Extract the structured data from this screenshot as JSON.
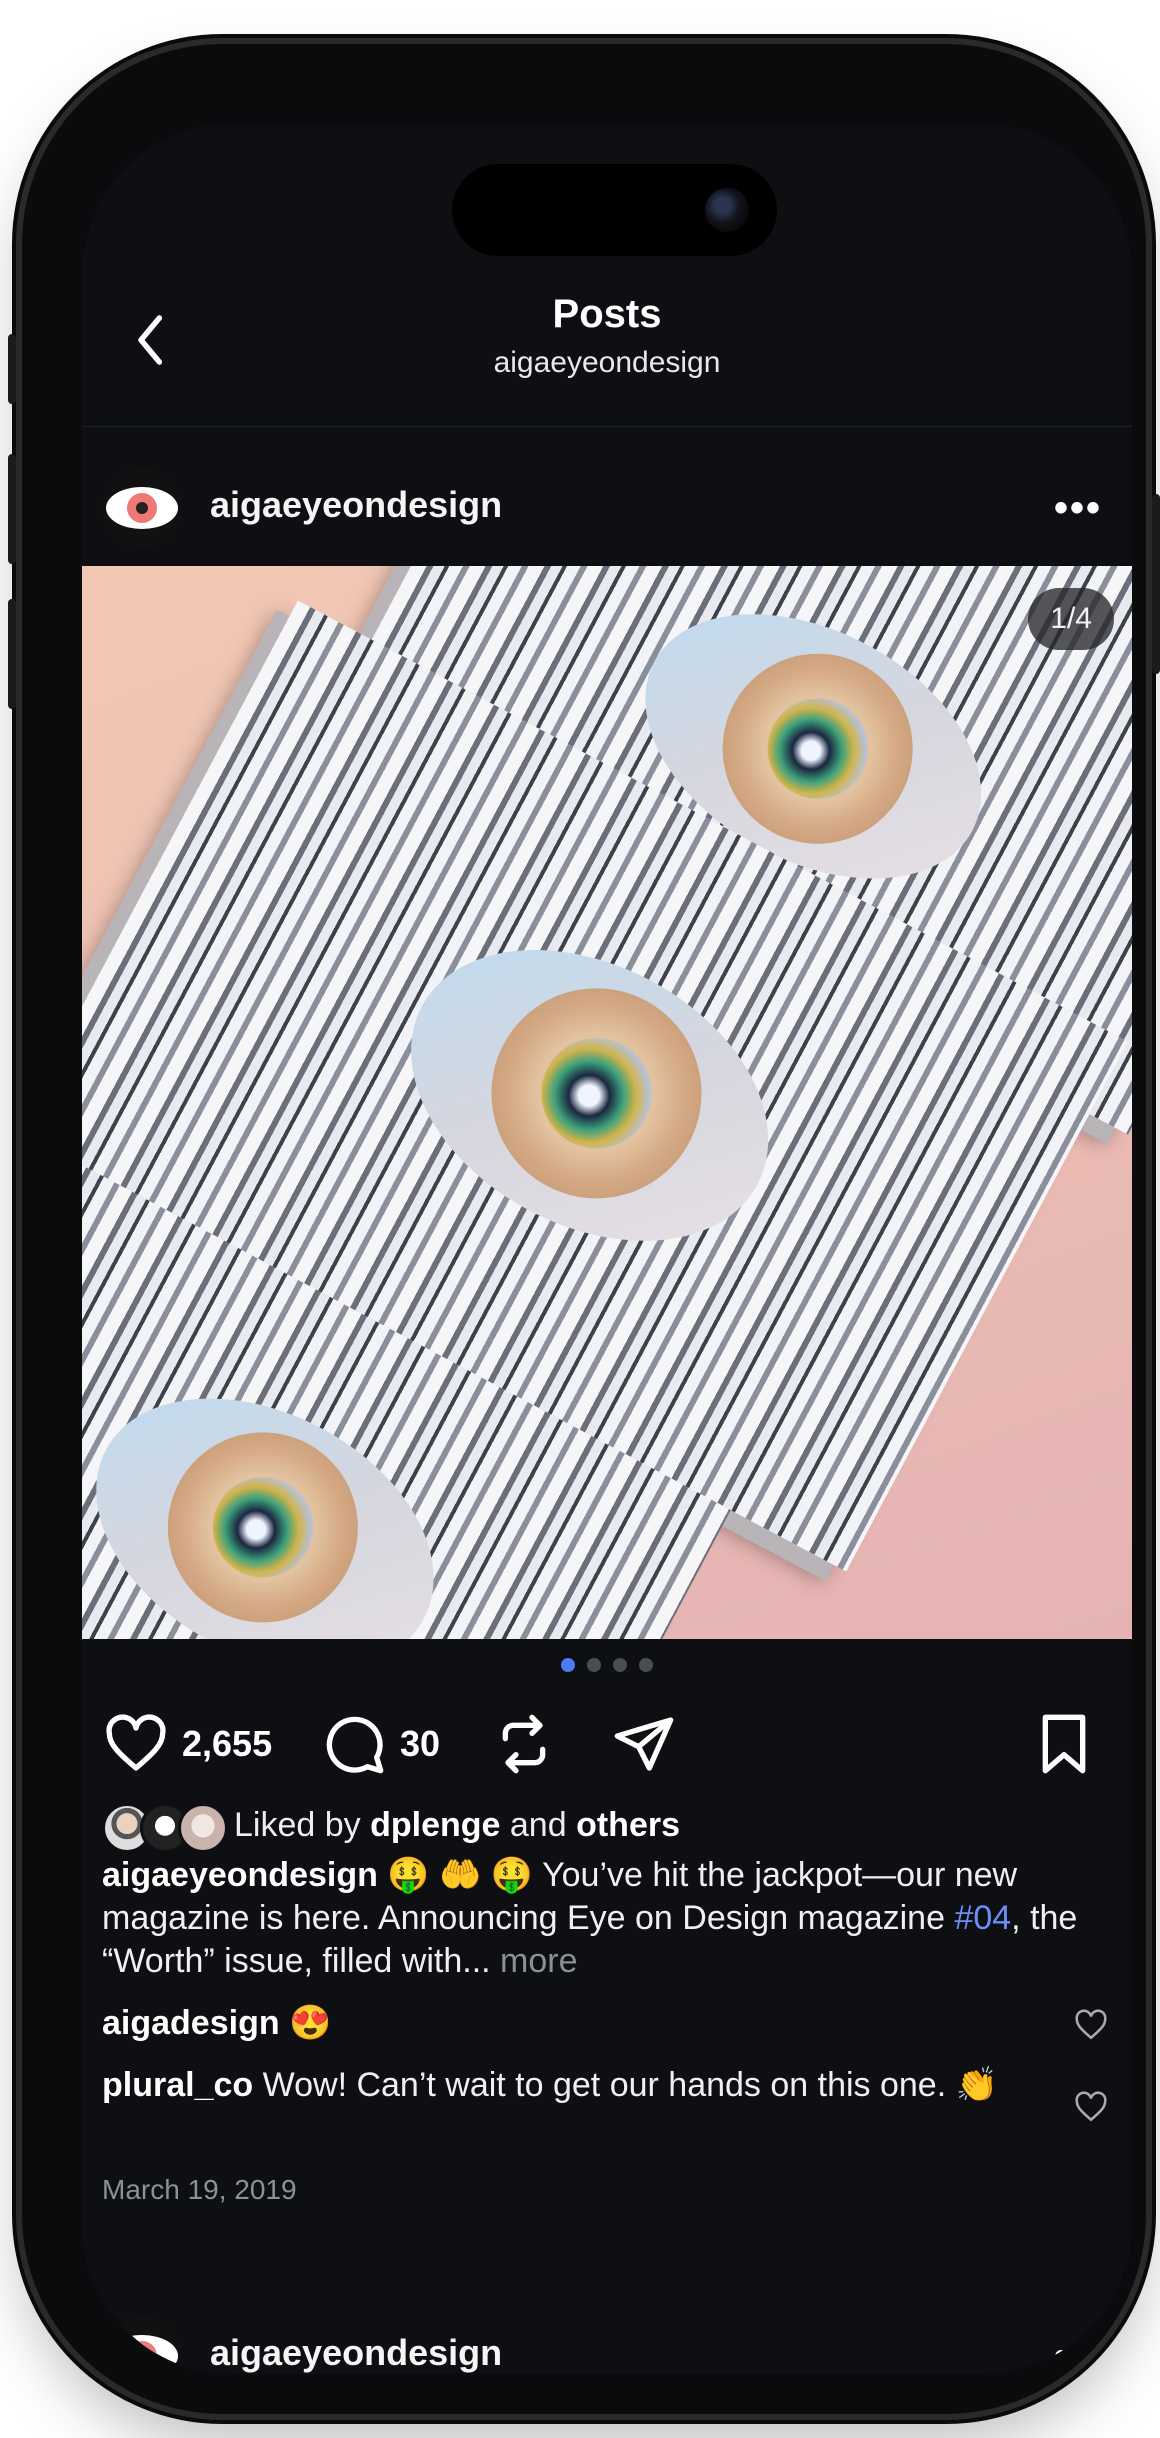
{
  "header": {
    "title": "Posts",
    "subtitle": "aigaeyeondesign"
  },
  "post": {
    "username": "aigaeyeondesign",
    "counter": "1/4",
    "likes_count": "2,655",
    "comments_count": "30",
    "liked_by_prefix": "Liked by",
    "liked_by_user": "dplenge",
    "liked_by_and": "and",
    "liked_by_others": "others",
    "caption_user": "aigaeyeondesign",
    "caption_emojis": "🤑 🤲 🤑",
    "caption_text_1": " You’ve hit the jackpot—our new magazine is here. Announcing Eye on Design magazine ",
    "caption_tag": "#04",
    "caption_text_2": ", the “Worth” issue, filled with...",
    "caption_more": "more",
    "comments": [
      {
        "user": "aigadesign",
        "text": "😍"
      },
      {
        "user": "plural_co",
        "text": "Wow! Can’t wait to get our hands on this one. 👏"
      }
    ],
    "date": "March 19, 2019"
  },
  "next_post": {
    "username": "aigaeyeondesign"
  },
  "carousel": {
    "total": 4,
    "active_index": 0
  },
  "colors": {
    "background": "#0d0f13",
    "accent": "#4c7cf5",
    "hashtag": "#6b8ff7"
  }
}
